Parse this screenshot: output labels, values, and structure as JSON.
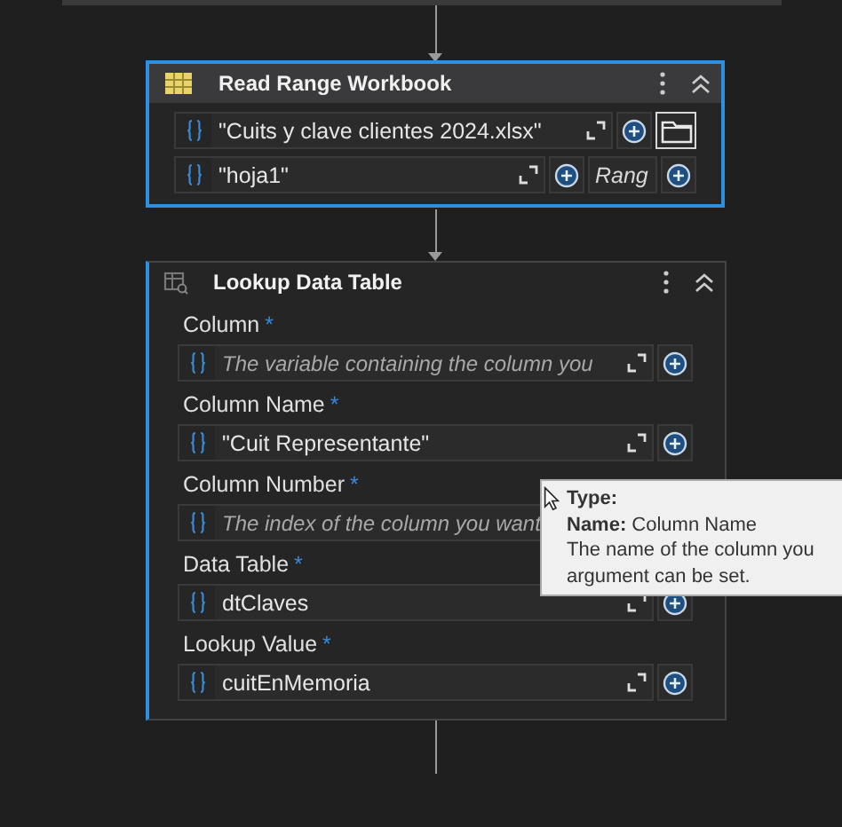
{
  "cards": [
    {
      "kind": "workbook",
      "title": "Read Range Workbook",
      "selected": true,
      "rows": [
        {
          "kind": "file",
          "value": "\"Cuits y clave clientes 2024.xlsx\"",
          "expand": true,
          "add": true
        },
        {
          "kind": "range",
          "value": "\"hoja1\"",
          "expand": true,
          "add": true,
          "range": "Rang"
        }
      ]
    },
    {
      "kind": "lookup",
      "title": "Lookup Data Table",
      "selected": false,
      "properties": [
        {
          "label": "Column",
          "required_mark": "*",
          "placeholder": "The variable containing the column you",
          "expand": true,
          "add": true
        },
        {
          "label": "Column Name",
          "required_mark": "*",
          "value": "\"Cuit Representante\"",
          "expand": true,
          "add": true
        },
        {
          "label": "Column Number",
          "required_mark": "*",
          "placeholder": "The index of the column you want",
          "expand": false,
          "add": false
        },
        {
          "label": "Data Table",
          "required_mark": "*",
          "value": "dtClaves",
          "expand": true,
          "add": true
        },
        {
          "label": "Lookup Value",
          "required_mark": "*",
          "value": "cuitEnMemoria",
          "expand": true,
          "add": true
        }
      ]
    }
  ],
  "tooltip": {
    "type_label": "Type:",
    "name_label": "Name:",
    "name": "Column Name",
    "description": "The name of the column you",
    "description_2": "argument can be set."
  }
}
